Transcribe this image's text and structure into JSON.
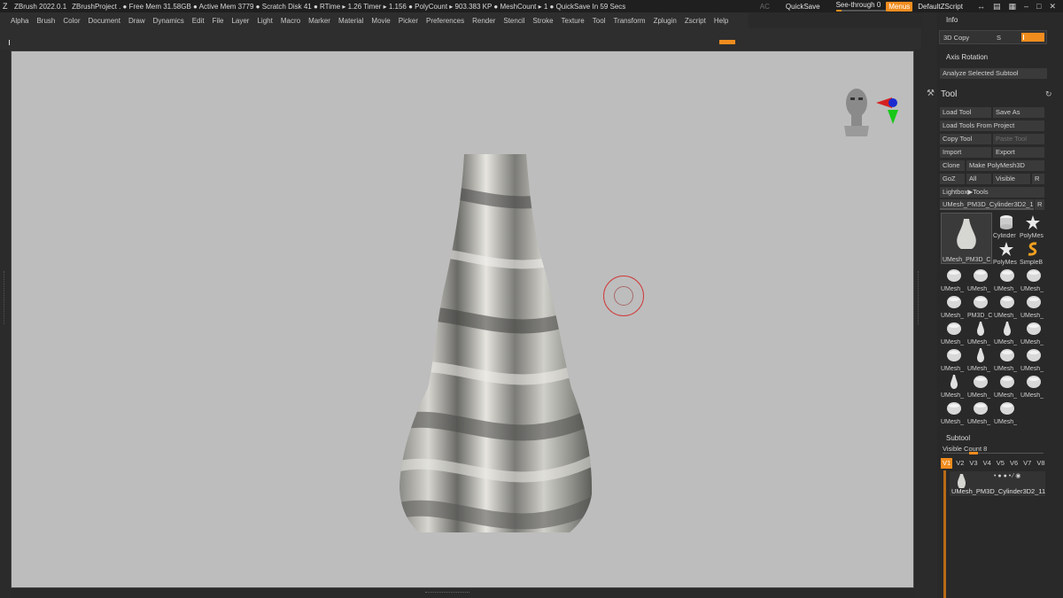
{
  "titlebar": {
    "app": "ZBrush 2022.0.1",
    "status": "ZBrushProject   . ● Free Mem 31.58GB ● Active Mem 3779 ● Scratch Disk 41  ● RTime ▸ 1.26 Timer ▸ 1.156 ● PolyCount ▸ 903.383 KP  ● MeshCount ▸ 1   ● QuickSave In 59 Secs",
    "ac": "AC",
    "quicksave": "QuickSave",
    "seethrough": "See-through  0",
    "seethrough_value": 0,
    "menus": "Menus",
    "script": "DefaultZScript"
  },
  "menubar": [
    "Alpha",
    "Brush",
    "Color",
    "Document",
    "Draw",
    "Dynamics",
    "Edit",
    "File",
    "Layer",
    "Light",
    "Macro",
    "Marker",
    "Material",
    "Movie",
    "Picker",
    "Preferences",
    "Render",
    "Stencil",
    "Stroke",
    "Texture",
    "Tool",
    "Transform",
    "Zplugin",
    "Zscript",
    "Help"
  ],
  "info": {
    "title": "Info",
    "copy_label": "3D Copy",
    "copy_s": "S"
  },
  "axis": {
    "title": "Axis Rotation",
    "analyze": "Analyze Selected Subtool"
  },
  "tool": {
    "title": "Tool",
    "buttons": {
      "load_tool": "Load Tool",
      "save_as": "Save As",
      "load_from_project": "Load Tools From Project",
      "copy_tool": "Copy Tool",
      "paste_tool": "Paste Tool",
      "import": "Import",
      "export": "Export",
      "clone": "Clone",
      "make_polymesh": "Make PolyMesh3D",
      "goz": "GoZ",
      "all": "All",
      "visible": "Visible",
      "r": "R",
      "lightbox": "Lightbox▶Tools",
      "current_tool": "UMesh_PM3D_Cylinder3D2_1",
      "current_r": "R"
    },
    "big_thumb_label": "UMesh_PM3D_C",
    "thumbs": [
      {
        "label": "Cylinder",
        "icon": "cylinder-icon"
      },
      {
        "label": "PolyMes",
        "icon": "star-icon"
      },
      {
        "label": "PolyMes",
        "icon": "star-icon"
      },
      {
        "label": "SimpleB",
        "icon": "simplebrush-icon"
      },
      {
        "label": "UMesh_",
        "icon": "mesh-icon"
      },
      {
        "label": "UMesh_",
        "icon": "mesh-icon"
      },
      {
        "label": "UMesh_",
        "icon": "mesh-icon"
      },
      {
        "label": "UMesh_",
        "icon": "mesh-icon"
      },
      {
        "label": "UMesh_",
        "icon": "mesh-icon"
      },
      {
        "label": "PM3D_C",
        "icon": "mesh-icon"
      },
      {
        "label": "UMesh_",
        "icon": "mesh-icon"
      },
      {
        "label": "UMesh_",
        "icon": "mesh-icon"
      },
      {
        "label": "UMesh_",
        "icon": "mesh-icon"
      },
      {
        "label": "UMesh_",
        "icon": "vase-icon"
      },
      {
        "label": "UMesh_",
        "icon": "vase-icon"
      },
      {
        "label": "UMesh_",
        "icon": "mesh-icon"
      },
      {
        "label": "UMesh_",
        "icon": "mesh-icon"
      },
      {
        "label": "UMesh_",
        "icon": "vase-icon"
      },
      {
        "label": "UMesh_",
        "icon": "mesh-icon"
      },
      {
        "label": "UMesh_",
        "icon": "mesh-icon"
      },
      {
        "label": "UMesh_",
        "icon": "vase-icon"
      },
      {
        "label": "UMesh_",
        "icon": "mesh-icon"
      },
      {
        "label": "UMesh_",
        "icon": "mesh-icon"
      },
      {
        "label": "UMesh_",
        "icon": "mesh-icon"
      },
      {
        "label": "UMesh_",
        "icon": "mesh-icon"
      },
      {
        "label": "UMesh_",
        "icon": "mesh-icon"
      },
      {
        "label": "UMesh_",
        "icon": "mesh-icon"
      }
    ]
  },
  "subtool": {
    "title": "Subtool",
    "visible_count": "Visible Count 8",
    "tabs": [
      "V1",
      "V2",
      "V3",
      "V4",
      "V5",
      "V6",
      "V7",
      "V8"
    ],
    "active_tab": "V1",
    "item": "UMesh_PM3D_Cylinder3D2_11"
  },
  "colors": {
    "accent": "#f08c1e",
    "canvas": "#bdbdbd",
    "panel": "#292929"
  }
}
